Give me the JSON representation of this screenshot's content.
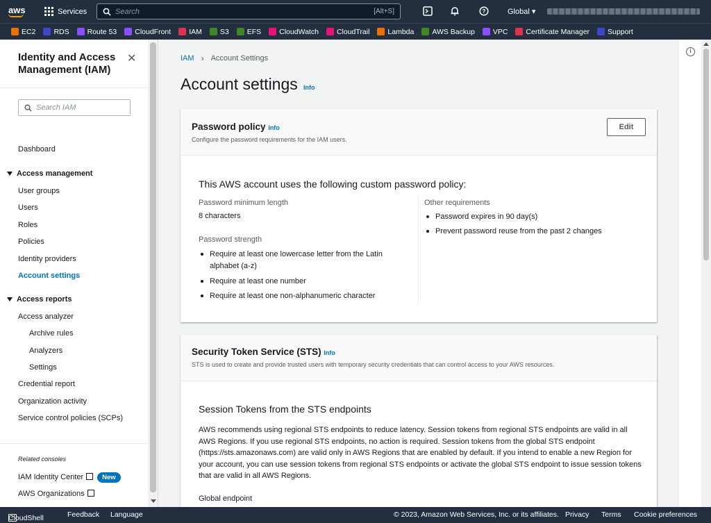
{
  "topnav": {
    "logo": "aws",
    "services_label": "Services",
    "search_placeholder": "Search",
    "search_shortcut": "[Alt+S]",
    "region": "Global"
  },
  "favorites": [
    {
      "label": "EC2",
      "color": "#ed7100"
    },
    {
      "label": "RDS",
      "color": "#3b48cc"
    },
    {
      "label": "Route 53",
      "color": "#8c4fff"
    },
    {
      "label": "CloudFront",
      "color": "#8c4fff"
    },
    {
      "label": "IAM",
      "color": "#dd344c"
    },
    {
      "label": "S3",
      "color": "#3f8624"
    },
    {
      "label": "EFS",
      "color": "#3f8624"
    },
    {
      "label": "CloudWatch",
      "color": "#e7157b"
    },
    {
      "label": "CloudTrail",
      "color": "#e7157b"
    },
    {
      "label": "Lambda",
      "color": "#ed7100"
    },
    {
      "label": "AWS Backup",
      "color": "#3f8624"
    },
    {
      "label": "VPC",
      "color": "#8c4fff"
    },
    {
      "label": "Certificate Manager",
      "color": "#dd344c"
    },
    {
      "label": "Support",
      "color": "#3b48cc"
    }
  ],
  "sidebar": {
    "title": "Identity and Access Management (IAM)",
    "search_placeholder": "Search IAM",
    "dashboard": "Dashboard",
    "access_management": "Access management",
    "am_items": [
      "User groups",
      "Users",
      "Roles",
      "Policies",
      "Identity providers",
      "Account settings"
    ],
    "access_reports": "Access reports",
    "access_analyzer": "Access analyzer",
    "analyzer_sub": [
      "Archive rules",
      "Analyzers",
      "Settings"
    ],
    "report_items": [
      "Credential report",
      "Organization activity",
      "Service control policies (SCPs)"
    ],
    "related_consoles": "Related consoles",
    "identity_center": "IAM Identity Center",
    "new_badge": "New",
    "organizations": "AWS Organizations"
  },
  "breadcrumb": {
    "root": "IAM",
    "current": "Account Settings"
  },
  "page": {
    "title": "Account settings",
    "info": "Info"
  },
  "password_policy": {
    "title": "Password policy",
    "info": "Info",
    "description": "Configure the password requirements for the IAM users.",
    "edit_label": "Edit",
    "heading": "This AWS account uses the following custom password policy:",
    "min_length_label": "Password minimum length",
    "min_length_value": "8 characters",
    "strength_label": "Password strength",
    "strength_items": [
      "Require at least one lowercase letter from the Latin alphabet (a-z)",
      "Require at least one number",
      "Require at least one non-alphanumeric character"
    ],
    "other_label": "Other requirements",
    "other_items": [
      "Password expires in 90 day(s)",
      "Prevent password reuse from the past 2 changes"
    ]
  },
  "sts": {
    "title": "Security Token Service (STS)",
    "info": "Info",
    "description": "STS is used to create and provide trusted users with temporary security credentials that can control access to your AWS resources.",
    "heading": "Session Tokens from the STS endpoints",
    "paragraph": "AWS recommends using regional STS endpoints to reduce latency. Session tokens from regional STS endpoints are valid in all AWS Regions. If you use regional STS endpoints, no action is required. Session tokens from the global STS endpoint (https://sts.amazonaws.com) are valid only in AWS Regions that are enabled by default. If you intend to enable a new Region for your account, you can use session tokens from regional STS endpoints or activate the global STS endpoint to issue session tokens that are valid in all AWS Regions.",
    "global_endpoint_label": "Global endpoint"
  },
  "footer": {
    "cloudshell": "CloudShell",
    "feedback": "Feedback",
    "language": "Language",
    "copyright": "© 2023, Amazon Web Services, Inc. or its affiliates.",
    "privacy": "Privacy",
    "terms": "Terms",
    "cookie": "Cookie preferences"
  }
}
